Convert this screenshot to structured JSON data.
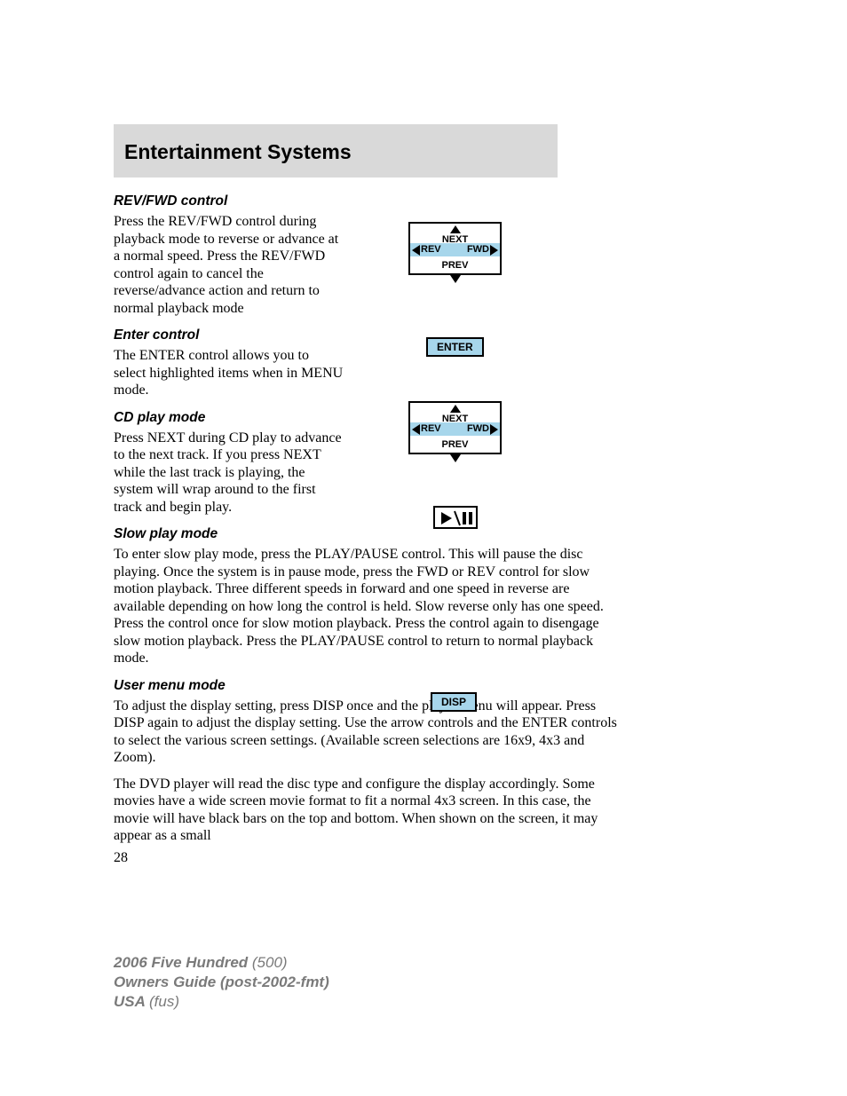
{
  "header": {
    "title": "Entertainment Systems"
  },
  "sections": {
    "revfwd": {
      "heading": "REV/FWD control",
      "body": "Press the REV/FWD control during playback mode to reverse or advance at a normal speed. Press the REV/FWD control again to cancel the reverse/advance action and return to normal playback mode"
    },
    "enter": {
      "heading": "Enter control",
      "body": "The ENTER control allows you to select highlighted items when in MENU mode."
    },
    "cdplay": {
      "heading": "CD play mode",
      "body": "Press NEXT during CD play to advance to the next track. If you press NEXT while the last track is playing, the system will wrap around to the first track and begin play."
    },
    "slow": {
      "heading": "Slow play mode",
      "body": "To enter slow play mode, press the PLAY/PAUSE control. This will pause the disc playing. Once the system is in pause mode, press the FWD or REV control for slow motion playback. Three different speeds in forward and one speed in reverse are available depending on how long the control is held. Slow reverse only has one speed. Press the control once for slow motion playback. Press the control again to disengage slow motion playback. Press the PLAY/PAUSE control to return to normal playback mode."
    },
    "usermenu": {
      "heading": "User menu mode",
      "body1": "To adjust the display setting, press DISP once and the player menu will appear. Press DISP again to adjust the display setting. Use the arrow controls and the ENTER controls to select the various screen settings. (Available screen selections are 16x9, 4x3 and Zoom).",
      "body2": "The DVD player will read the disc type and configure the display accordingly. Some movies have a wide screen movie format to fit a normal 4x3 screen. In this case, the movie will have black bars on the top and bottom. When shown on the screen, it may appear as a small"
    }
  },
  "dpad": {
    "next": "NEXT",
    "prev": "PREV",
    "rev": "REV",
    "fwd": "FWD"
  },
  "buttons": {
    "enter": "ENTER",
    "disp": "DISP"
  },
  "page_number": "28",
  "footer": {
    "line1a": "2006 Five Hundred ",
    "line1b": "(500)",
    "line2": "Owners Guide (post-2002-fmt)",
    "line3a": "USA ",
    "line3b": "(fus)"
  }
}
